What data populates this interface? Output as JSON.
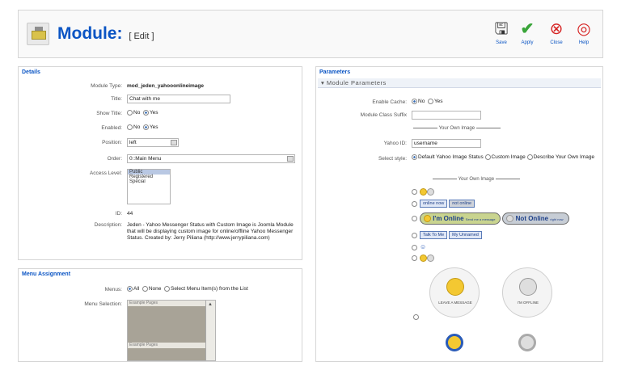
{
  "header": {
    "title": "Module:",
    "subtitle": "[ Edit ]",
    "buttons": [
      {
        "icon": "save-icon",
        "label": "Save"
      },
      {
        "icon": "apply-icon",
        "label": "Apply"
      },
      {
        "icon": "close-icon",
        "label": "Close"
      },
      {
        "icon": "help-icon",
        "label": "Help"
      }
    ]
  },
  "details": {
    "legend": "Details",
    "module_type_label": "Module Type:",
    "module_type_value": "mod_jeden_yahooonlineimage",
    "title_label": "Title:",
    "title_value": "Chat with me",
    "show_title_label": "Show Title:",
    "enabled_label": "Enabled:",
    "no": "No",
    "yes": "Yes",
    "position_label": "Position:",
    "position_value": "left",
    "order_label": "Order:",
    "order_value": "0::Main Menu",
    "access_label": "Access Level:",
    "access_options": [
      "Public",
      "Registered",
      "Special"
    ],
    "id_label": "ID:",
    "id_value": "44",
    "description_label": "Description:",
    "description_value": "Jeden - Yahoo Messenger Status with Custom Image is Joomla Module that will be displaying custom image for online/offline Yahoo Messenger Status. Created by: Jerry Piliana (http://www.jerrypiliana.com)"
  },
  "menu": {
    "legend": "Menu Assignment",
    "menus_label": "Menus:",
    "all": "All",
    "none": "None",
    "select": "Select Menu Item(s) from the List",
    "selection_label": "Menu Selection:",
    "list_items": [
      "Example Pages",
      "Example Pages"
    ]
  },
  "params": {
    "legend": "Parameters",
    "header": "Module Parameters",
    "cache_label": "Enable Cache:",
    "no": "No",
    "yes": "Yes",
    "suffix_label": "Module Class Suffix",
    "own_image_1": "Your Own Image",
    "yahoo_id_label": "Yahoo ID:",
    "yahoo_id_value": "username",
    "style_label": "Select style:",
    "style_default": "Default Yahoo Image Status",
    "style_custom": "Custom Image",
    "style_describe": "Describe Your Own Image",
    "own_image_2": "Your Own Image",
    "badge_online": "online now",
    "badge_offline": "not online",
    "pill_online": "I'm Online",
    "pill_online_sub": "Send me a message",
    "pill_offline": "Not Online",
    "pill_offline_sub": "right now",
    "talk": "Talk To Me",
    "unavail": "My Unnamed",
    "circle1_caption": "LEAVE A MESSAGE",
    "circle2_caption": "I'M OFFLINE"
  }
}
